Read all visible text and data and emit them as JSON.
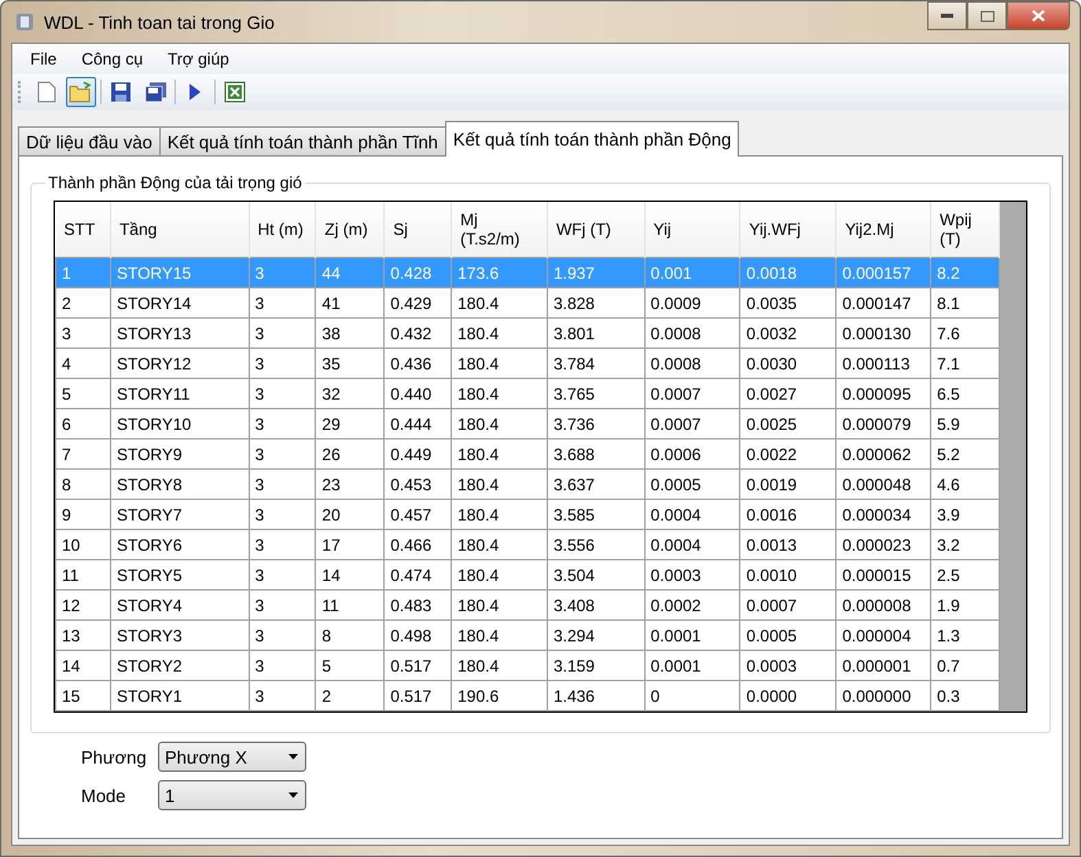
{
  "window": {
    "title": "WDL - Tinh toan tai trong Gio"
  },
  "menu": [
    "File",
    "Công cụ",
    "Trợ giúp"
  ],
  "toolbar": [
    {
      "kind": "new",
      "selected": false
    },
    {
      "kind": "open",
      "selected": true
    },
    {
      "kind": "save",
      "selected": false
    },
    {
      "kind": "saveall",
      "selected": false
    },
    {
      "kind": "run",
      "selected": false
    },
    {
      "kind": "excel",
      "selected": false
    }
  ],
  "tabs": [
    {
      "label": "Dữ liệu đầu vào",
      "selected": false
    },
    {
      "label": "Kết quả tính toán thành phần Tĩnh",
      "selected": false
    },
    {
      "label": "Kết quả tính toán thành phần Động",
      "selected": true
    }
  ],
  "group": {
    "title": "Thành phần Động của tải trọng gió"
  },
  "table": {
    "columns": [
      "STT",
      "Tầng",
      "Ht (m)",
      "Zj (m)",
      "Sj",
      "Mj\n(T.s2/m)",
      "WFj (T)",
      "Yij",
      "Yij.WFj",
      "Yij2.Mj",
      "Wpij\n(T)"
    ],
    "rows": [
      {
        "selected": true,
        "cells": [
          "1",
          "STORY15",
          "3",
          "44",
          "0.428",
          "173.6",
          "1.937",
          "0.001",
          "0.0018",
          "0.000157",
          "8.2"
        ]
      },
      {
        "selected": false,
        "cells": [
          "2",
          "STORY14",
          "3",
          "41",
          "0.429",
          "180.4",
          "3.828",
          "0.0009",
          "0.0035",
          "0.000147",
          "8.1"
        ]
      },
      {
        "selected": false,
        "cells": [
          "3",
          "STORY13",
          "3",
          "38",
          "0.432",
          "180.4",
          "3.801",
          "0.0008",
          "0.0032",
          "0.000130",
          "7.6"
        ]
      },
      {
        "selected": false,
        "cells": [
          "4",
          "STORY12",
          "3",
          "35",
          "0.436",
          "180.4",
          "3.784",
          "0.0008",
          "0.0030",
          "0.000113",
          "7.1"
        ]
      },
      {
        "selected": false,
        "cells": [
          "5",
          "STORY11",
          "3",
          "32",
          "0.440",
          "180.4",
          "3.765",
          "0.0007",
          "0.0027",
          "0.000095",
          "6.5"
        ]
      },
      {
        "selected": false,
        "cells": [
          "6",
          "STORY10",
          "3",
          "29",
          "0.444",
          "180.4",
          "3.736",
          "0.0007",
          "0.0025",
          "0.000079",
          "5.9"
        ]
      },
      {
        "selected": false,
        "cells": [
          "7",
          "STORY9",
          "3",
          "26",
          "0.449",
          "180.4",
          "3.688",
          "0.0006",
          "0.0022",
          "0.000062",
          "5.2"
        ]
      },
      {
        "selected": false,
        "cells": [
          "8",
          "STORY8",
          "3",
          "23",
          "0.453",
          "180.4",
          "3.637",
          "0.0005",
          "0.0019",
          "0.000048",
          "4.6"
        ]
      },
      {
        "selected": false,
        "cells": [
          "9",
          "STORY7",
          "3",
          "20",
          "0.457",
          "180.4",
          "3.585",
          "0.0004",
          "0.0016",
          "0.000034",
          "3.9"
        ]
      },
      {
        "selected": false,
        "cells": [
          "10",
          "STORY6",
          "3",
          "17",
          "0.466",
          "180.4",
          "3.556",
          "0.0004",
          "0.0013",
          "0.000023",
          "3.2"
        ]
      },
      {
        "selected": false,
        "cells": [
          "11",
          "STORY5",
          "3",
          "14",
          "0.474",
          "180.4",
          "3.504",
          "0.0003",
          "0.0010",
          "0.000015",
          "2.5"
        ]
      },
      {
        "selected": false,
        "cells": [
          "12",
          "STORY4",
          "3",
          "11",
          "0.483",
          "180.4",
          "3.408",
          "0.0002",
          "0.0007",
          "0.000008",
          "1.9"
        ]
      },
      {
        "selected": false,
        "cells": [
          "13",
          "STORY3",
          "3",
          "8",
          "0.498",
          "180.4",
          "3.294",
          "0.0001",
          "0.0005",
          "0.000004",
          "1.3"
        ]
      },
      {
        "selected": false,
        "cells": [
          "14",
          "STORY2",
          "3",
          "5",
          "0.517",
          "180.4",
          "3.159",
          "0.0001",
          "0.0003",
          "0.000001",
          "0.7"
        ]
      },
      {
        "selected": false,
        "cells": [
          "15",
          "STORY1",
          "3",
          "2",
          "0.517",
          "190.6",
          "1.436",
          "0",
          "0.0000",
          "0.000000",
          "0.3"
        ]
      }
    ]
  },
  "fields": [
    {
      "label": "Phương",
      "value": "Phương X"
    },
    {
      "label": "Mode",
      "value": "1"
    }
  ]
}
